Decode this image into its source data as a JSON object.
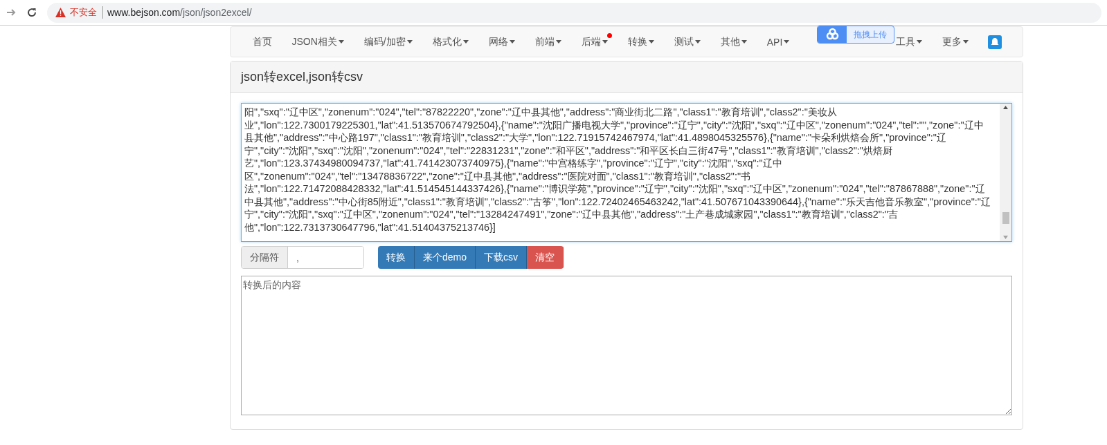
{
  "browser": {
    "security": "不安全",
    "url_host": "www.bejson.com",
    "url_path": "/json/json2excel/"
  },
  "nav": {
    "items": [
      {
        "label": "首页",
        "dropdown": false,
        "badge": false
      },
      {
        "label": "JSON相关",
        "dropdown": true,
        "badge": false
      },
      {
        "label": "编码/加密",
        "dropdown": true,
        "badge": false
      },
      {
        "label": "格式化",
        "dropdown": true,
        "badge": false
      },
      {
        "label": "网络",
        "dropdown": true,
        "badge": false
      },
      {
        "label": "前端",
        "dropdown": true,
        "badge": false
      },
      {
        "label": "后端",
        "dropdown": true,
        "badge": true
      },
      {
        "label": "转换",
        "dropdown": true,
        "badge": false
      },
      {
        "label": "测试",
        "dropdown": true,
        "badge": false
      },
      {
        "label": "其他",
        "dropdown": true,
        "badge": false
      },
      {
        "label": "API",
        "dropdown": true,
        "badge": false
      },
      {
        "label": "工具",
        "dropdown": true,
        "badge": false,
        "covered": true
      },
      {
        "label": "更多",
        "dropdown": true,
        "badge": false
      }
    ]
  },
  "upload_widget": {
    "label": "拖拽上传"
  },
  "panel": {
    "title": "json转excel,json转csv"
  },
  "input_lines": [
    "阳\",\"sxq\":\"辽中区\",\"zonenum\":\"024\",\"tel\":\"87822220\",\"zone\":\"辽中县其他\",\"address\":\"商业街北二路\",\"class1\":\"教育培训\",\"class2\":\"美妆从",
    "业\",\"lon\":122.7300179225301,\"lat\":41.513570674792504},{\"name\":\"沈阳广播电视大学\",\"province\":\"辽宁\",\"city\":\"沈阳\",\"sxq\":\"辽中区\",\"zonenum\":\"024\",\"tel\":\"\",\"zone\":\"辽中",
    "县其他\",\"address\":\"中心路197\",\"class1\":\"教育培训\",\"class2\":\"大学\",\"lon\":122.71915742467974,\"lat\":41.4898045325576},{\"name\":\"卡朵利烘焙会所\",\"province\":\"辽",
    "宁\",\"city\":\"沈阳\",\"sxq\":\"沈阳\",\"zonenum\":\"024\",\"tel\":\"22831231\",\"zone\":\"和平区\",\"address\":\"和平区长白三街47号\",\"class1\":\"教育培训\",\"class2\":\"烘焙厨",
    "艺\",\"lon\":123.37434980094737,\"lat\":41.741423073740975},{\"name\":\"中宫格练字\",\"province\":\"辽宁\",\"city\":\"沈阳\",\"sxq\":\"辽中",
    "区\",\"zonenum\":\"024\",\"tel\":\"13478836722\",\"zone\":\"辽中县其他\",\"address\":\"医院对面\",\"class1\":\"教育培训\",\"class2\":\"书",
    "法\",\"lon\":122.71472088428332,\"lat\":41.514545144337426},{\"name\":\"博识学苑\",\"province\":\"辽宁\",\"city\":\"沈阳\",\"sxq\":\"辽中区\",\"zonenum\":\"024\",\"tel\":\"87867888\",\"zone\":\"辽",
    "中县其他\",\"address\":\"中心街85附近\",\"class1\":\"教育培训\",\"class2\":\"古筝\",\"lon\":122.72402465463242,\"lat\":41.507671043390644},{\"name\":\"乐天吉他音乐教室\",\"province\":\"辽",
    "宁\",\"city\":\"沈阳\",\"sxq\":\"辽中区\",\"zonenum\":\"024\",\"tel\":\"13284247491\",\"zone\":\"辽中县其他\",\"address\":\"土产巷成城家园\",\"class1\":\"教育培训\",\"class2\":\"吉",
    "他\",\"lon\":122.7313730647796,\"lat\":41.51404375213746}]"
  ],
  "separator": {
    "label": "分隔符",
    "value": ","
  },
  "buttons": [
    {
      "label": "转换",
      "kind": "primary"
    },
    {
      "label": "来个demo",
      "kind": "primary"
    },
    {
      "label": "下载csv",
      "kind": "primary"
    },
    {
      "label": "清空",
      "kind": "danger"
    }
  ],
  "output": {
    "placeholder": "转换后的内容"
  }
}
